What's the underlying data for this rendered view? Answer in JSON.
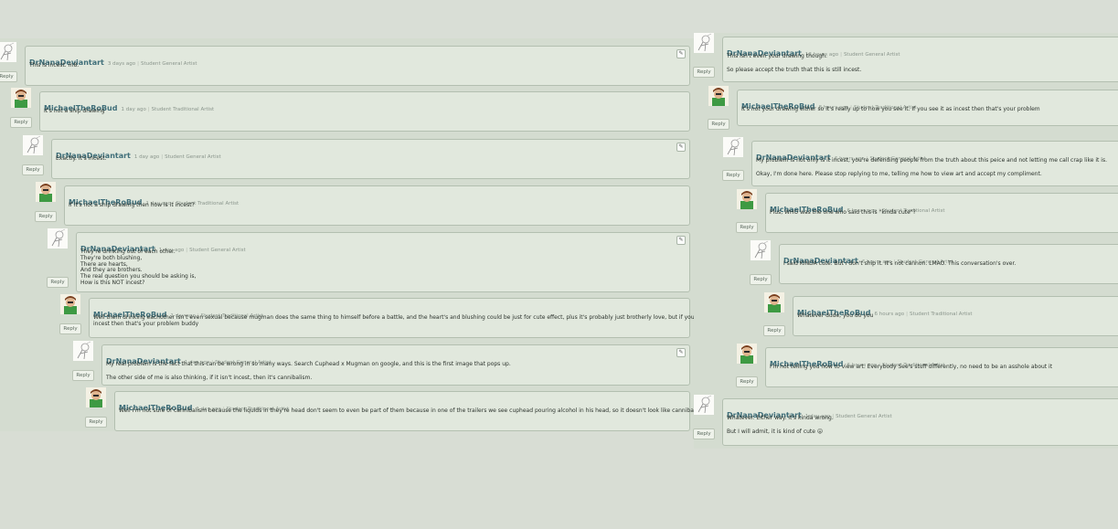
{
  "reply_label": "Reply",
  "left_thread": [
    {
      "user": "DrNanaDeviantart",
      "time": "3 days ago",
      "role": "Student General Artist",
      "lines": [
        "This is incest. m8."
      ],
      "edit": true
    },
    {
      "user": "MichaelTheRoBud",
      "time": "1 day ago",
      "role": "Student Traditional Artist",
      "lines": [
        "It's not a ship drawing"
      ],
      "edit": false
    },
    {
      "user": "DrNanaDeviantart",
      "time": "1 day ago",
      "role": "Student General Artist",
      "lines": [
        "Exactly. It's incest."
      ],
      "edit": true
    },
    {
      "user": "MichaelTheRoBud",
      "time": "1 day ago",
      "role": "Student Traditional Artist",
      "lines": [
        "If it's not a ship drawing then how is it incest?"
      ],
      "edit": false
    },
    {
      "user": "DrNanaDeviantart",
      "time": "1 day ago",
      "role": "Student General Artist",
      "lines": [
        "They're drinking out of each other.",
        "They're both blushing,",
        "There are hearts,",
        "And they are brothers.",
        "The real question you should be asking is,",
        "How is this NOT incest?"
      ],
      "edit": true
    },
    {
      "user": "MichaelTheRoBud",
      "time": "1 day ago",
      "role": "Student Traditional Artist",
      "lines": [
        "Well them drinking eachother isn't even sexual because mugman does the same thing to himself before a battle, and the heart's and blushing could be just for cute effect, plus it's probably just brotherly love, but if you see it as",
        "incest then that's your problem buddy"
      ],
      "edit": false
    },
    {
      "user": "DrNanaDeviantart",
      "time": "1 day ago",
      "role": "Student General Artist",
      "lines": [
        "My real problem is the fact that this can be wrong in so many ways. Search Cuphead x Mugman on google, and this is the first image that pops up.",
        "",
        "The other side of me is also thinking, if it isn't incest, then it's cannibalism."
      ],
      "edit": true
    },
    {
      "user": "MichaelTheRoBud",
      "time": "1 day ago",
      "role": "Student Traditional Artist",
      "lines": [
        "Well I'm not sure of cannibalism because the liquids in they're head don't seem to even be part of them because in one of the trailers we see cuphead pouring alcohol in his head, so it doesn't look like cannibalism"
      ],
      "edit": false
    }
  ],
  "right_thread": [
    {
      "user": "DrNanaDeviantart",
      "time": "13 hours ago",
      "role": "Student General Artist",
      "lines": [
        "This isn't even your drawing though.",
        "",
        "So please accept the truth that this is still incest."
      ],
      "edit": false
    },
    {
      "user": "MichaelTheRoBud",
      "time": "8 hours ago",
      "role": "Student Traditional Artist",
      "lines": [
        "It's not your drawing either so it's really up to how you see it. If you see it as incest then that's your problem"
      ],
      "edit": false
    },
    {
      "user": "DrNanaDeviantart",
      "time": "6 hours ago",
      "role": "Student General Artist",
      "lines": [
        "My problem is not only is it incest, you're defending people from the truth about this peice and not letting me call crap like it is.",
        "",
        "Okay, I'm done here. Please stop replying to me, telling me how to view art and accept my compliment."
      ],
      "edit": false
    },
    {
      "user": "MichaelTheRoBud",
      "time": "6 hours ago",
      "role": "Student Traditional Artist",
      "lines": [
        "Plus, WHO was the one who said this is \"kinda cute\"?"
      ],
      "edit": false
    },
    {
      "user": "DrNanaDeviantart",
      "time": "6 hours ago",
      "role": "Student General Artist",
      "lines": [
        "I said KINDA cute. But I don't ship it. It's not cannon. LMAO. This conversation's over."
      ],
      "edit": false
    },
    {
      "user": "MichaelTheRoBud",
      "time": "6 hours ago",
      "role": "Student Traditional Artist",
      "lines": [
        "Whatever dude, you do you"
      ],
      "edit": false
    },
    {
      "user": "MichaelTheRoBud",
      "time": "6 hours ago",
      "role": "Student Traditional Artist",
      "lines": [
        "I'm not telling you how to view art. Everybody See's stuff differently, no need to be an asshole about it"
      ],
      "edit": false
    },
    {
      "user": "DrNanaDeviantart",
      "time": "1 day ago",
      "role": "Student General Artist",
      "lines": [
        "Whatever. Either way. It's kinda wrong.",
        "",
        "But I will admit, it is kind of cute 😛"
      ],
      "edit": false
    }
  ]
}
